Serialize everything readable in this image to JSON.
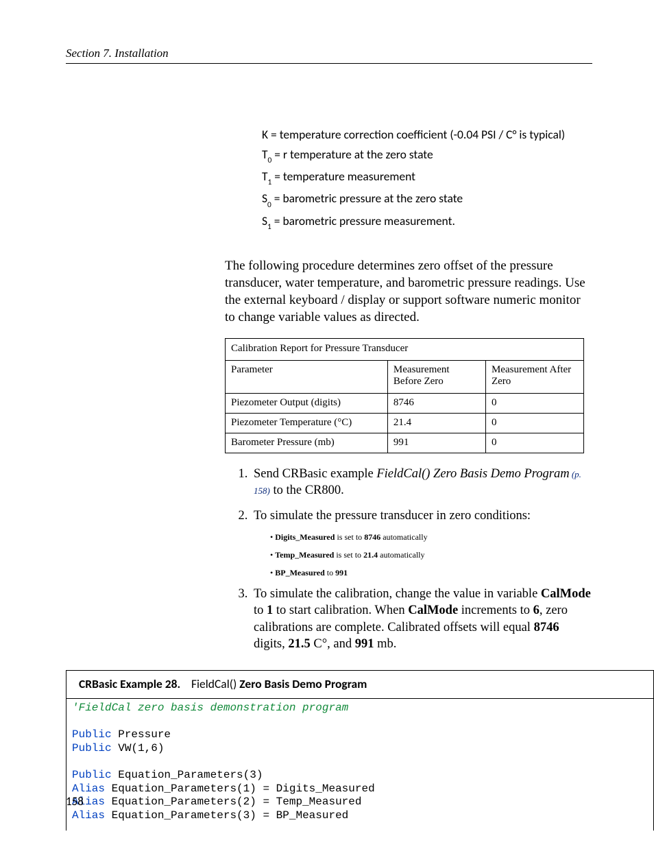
{
  "header": {
    "running_head": "Section 7.  Installation"
  },
  "defs": {
    "K": "K =  temperature correction coefficient (-0.04 PSI / C° is typical)",
    "T0_pre": "T",
    "T0_sub": "0",
    "T0_post": " = r temperature at the zero state",
    "T1_pre": "T",
    "T1_sub": "1",
    "T1_post": " =  temperature measurement",
    "S0_pre": "S",
    "S0_sub": "0",
    "S0_post": " = barometric pressure at the zero state",
    "S1_pre": "S",
    "S1_sub": "1",
    "S1_post": " = barometric pressure measurement."
  },
  "para1": "The following procedure determines zero offset of the pressure transducer, water temperature, and barometric pressure readings.  Use the external keyboard / display or support software numeric monitor to change variable values as directed.",
  "table": {
    "title": "Calibration Report for Pressure Transducer",
    "headers": [
      "Parameter",
      "Measurement Before Zero",
      "Measurement After Zero"
    ],
    "rows": [
      [
        "Piezometer Output (digits)",
        "8746",
        "0"
      ],
      [
        "Piezometer Temperature (°C)",
        "21.4",
        "0"
      ],
      [
        "Barometer Pressure (mb)",
        "991",
        "0"
      ]
    ]
  },
  "steps": {
    "s1_a": "Send CRBasic example ",
    "s1_i": "FieldCal() Zero Basis Demo Program",
    "s1_ref": " (p. 158)",
    "s1_b": " to the CR800.",
    "s2": "To simulate the pressure transducer in zero conditions:",
    "s2_b1_a": "Digits_Measured",
    "s2_b1_b": " is set to ",
    "s2_b1_c": "8746",
    "s2_b1_d": " automatically",
    "s2_b2_a": "Temp_Measured",
    "s2_b2_b": " is set to ",
    "s2_b2_c": "21.4",
    "s2_b2_d": " automatically",
    "s2_b3_a": "BP_Measured",
    "s2_b3_b": " to ",
    "s2_b3_c": "991",
    "s3_a": "To simulate the calibration, change the value in variable ",
    "s3_b": "CalMode",
    "s3_c": " to ",
    "s3_d": "1",
    "s3_e": " to start calibration. When ",
    "s3_f": "CalMode",
    "s3_g": " increments to ",
    "s3_h": "6",
    "s3_i": ", zero calibrations are complete. Calibrated offsets will equal ",
    "s3_j": "8746",
    "s3_k": " digits, ",
    "s3_l": "21.5",
    "s3_m": " C°, and ",
    "s3_n": "991",
    "s3_o": " mb."
  },
  "codebox": {
    "title_lead": "CRBasic Example 28.",
    "title_mid": "FieldCal()",
    "title_tail": " Zero Basis Demo Program",
    "lines": [
      {
        "cm": "'FieldCal zero basis demonstration program"
      },
      {
        "blank": true
      },
      {
        "kw": "Public",
        "pl": " Pressure"
      },
      {
        "kw": "Public",
        "pl": " VW(1,6)"
      },
      {
        "blank": true
      },
      {
        "kw": "Public",
        "pl": " Equation_Parameters(3)"
      },
      {
        "kw": "Alias",
        "pl": " Equation_Parameters(1) = Digits_Measured"
      },
      {
        "kw": "Alias",
        "pl": " Equation_Parameters(2) = Temp_Measured"
      },
      {
        "kw": "Alias",
        "pl": " Equation_Parameters(3) = BP_Measured"
      }
    ]
  },
  "page_number": "158"
}
